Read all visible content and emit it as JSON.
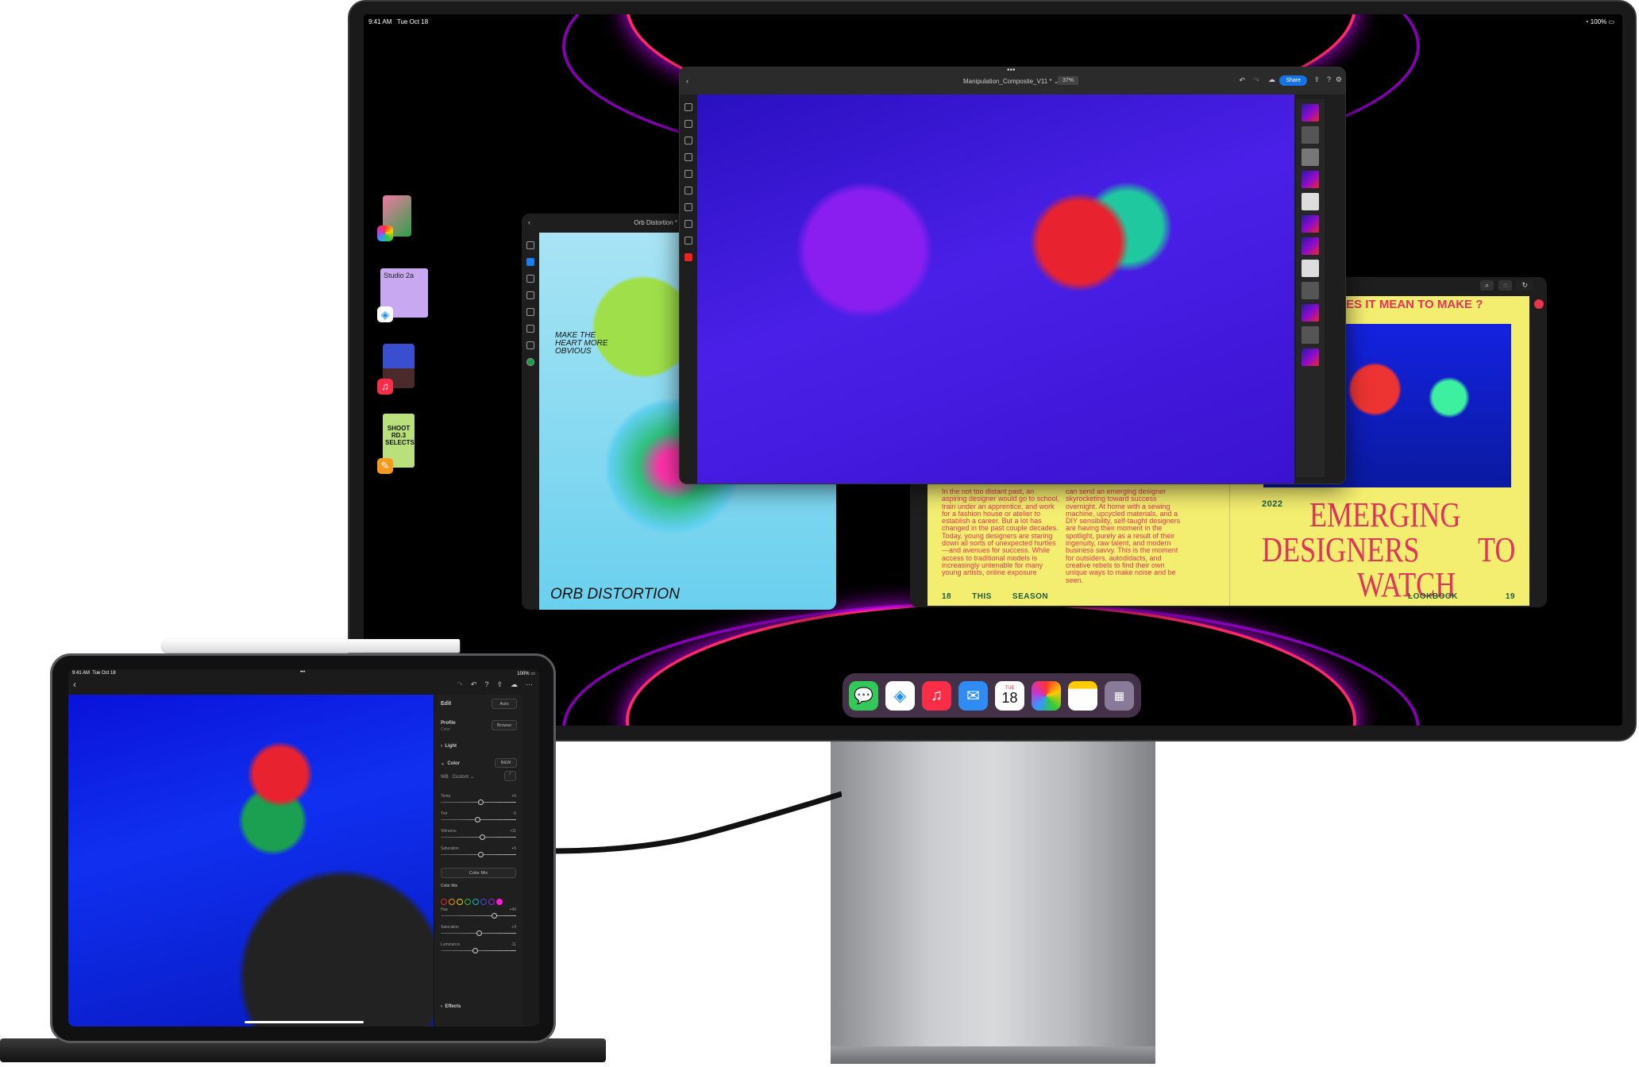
{
  "display": {
    "status_bar": {
      "time": "9:41 AM",
      "date": "Tue Oct 18",
      "battery": "100%"
    },
    "stage_manager": [
      {
        "app": "Photos",
        "icon": "photos-icon"
      },
      {
        "app": "Safari",
        "icon": "safari-icon",
        "preview_text": "Studio 2a"
      },
      {
        "app": "Music",
        "icon": "music-icon"
      },
      {
        "app": "Pages",
        "icon": "pages-icon",
        "preview_text": "SHOOT RD.3 SELECTS"
      }
    ],
    "photoshop": {
      "file_name": "Manipulation_Composite_V11 *",
      "zoom": "37%",
      "share_label": "Share"
    },
    "fresco": {
      "title": "Orb Distortion *",
      "caption_top": "MAKE THE HEART MORE OBVIOUS",
      "caption_bottom": "ORB DISTORTION"
    },
    "magazine": {
      "heading": "WHAT DOES IT MEAN TO MAKE ?",
      "col1": "In the not too distant past, an aspiring designer would go to school, train under an apprentice, and work for a fashion house or atelier to establish a career. But a lot has changed in the past couple decades. Today, young designers are staring down all sorts of unexpected hurtles—and avenues for success. While access to traditional models is increasingly untenable for many young artists, online exposure",
      "col2": "can send an emerging designer skyrocketing toward success overnight. At home with a sewing machine, upcycled materials, and a DIY sensibility, self-taught designers are having their moment in the spotlight, purely as a result of their ingenuity, raw talent, and modern business savvy. This is the moment for outsiders, autodidacts, and creative rebels to find their own unique ways to make noise and be seen.",
      "year": "2022",
      "title_line1": "EMERGING",
      "title_line2a": "DESIGNERS",
      "title_line2b": "TO",
      "title_line3": "WATCH",
      "footer_left": [
        "18",
        "THIS",
        "SEASON"
      ],
      "footer_right": [
        "LOOKBOOK",
        "19"
      ]
    },
    "dock": [
      {
        "app": "Messages",
        "icon": "messages-icon",
        "color": "#34c759"
      },
      {
        "app": "Safari",
        "icon": "safari-icon",
        "color": "#1a8cff"
      },
      {
        "app": "Music",
        "icon": "music-icon",
        "color": "#fa2d48"
      },
      {
        "app": "Mail",
        "icon": "mail-icon",
        "color": "#2f8cf5"
      },
      {
        "app": "Calendar",
        "icon": "calendar-icon",
        "day": "TUE",
        "date": "18"
      },
      {
        "app": "Photos",
        "icon": "photos-icon"
      },
      {
        "app": "Notes",
        "icon": "notes-icon"
      },
      {
        "app": "App Library",
        "icon": "app-library-icon"
      }
    ]
  },
  "ipad": {
    "status_bar": {
      "time": "9:41 AM",
      "date": "Tue Oct 18",
      "battery": "100%"
    },
    "edit_panel": {
      "title": "Edit",
      "auto_label": "Auto",
      "profile_label": "Profile",
      "profile_value": "Color",
      "browse_label": "Browse",
      "light_label": "Light",
      "color_label": "Color",
      "bw_label": "B&W",
      "wb_label": "WB",
      "wb_value": "Custom",
      "sliders": [
        {
          "label": "Temp",
          "value": "+6",
          "level": 0.53
        },
        {
          "label": "Tint",
          "value": "-5",
          "level": 0.48
        },
        {
          "label": "Vibrance",
          "value": "+11",
          "level": 0.55
        },
        {
          "label": "Saturation",
          "value": "+5",
          "level": 0.53
        }
      ],
      "color_mix_button": "Color Mix",
      "color_mix_label": "Color Mix",
      "color_swatches": [
        "#e0242f",
        "#f08a1c",
        "#e8d000",
        "#36b34a",
        "#16b3c8",
        "#3a4fd0",
        "#9a1ee0",
        "#ff18d8"
      ],
      "mix_sliders": [
        {
          "label": "Hue",
          "value": "+40",
          "level": 0.7
        },
        {
          "label": "Saturation",
          "value": "+3",
          "level": 0.51
        },
        {
          "label": "Luminance",
          "value": "-11",
          "level": 0.45
        }
      ],
      "effects_label": "Effects"
    }
  }
}
